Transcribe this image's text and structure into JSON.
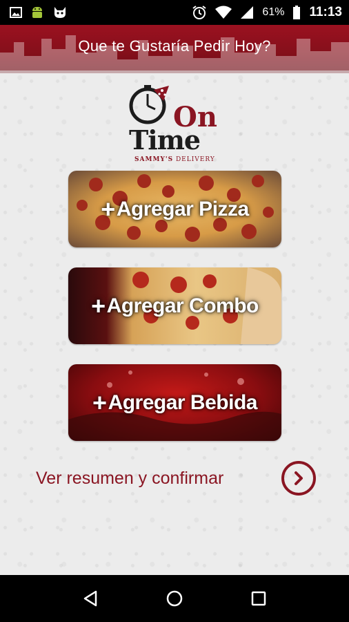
{
  "status_bar": {
    "left_icons": [
      "image-icon",
      "android-icon",
      "cat-icon"
    ],
    "right_icons": [
      "alarm-icon",
      "wifi-icon",
      "signal-icon"
    ],
    "battery": "61%",
    "time": "11:13"
  },
  "header": {
    "title": "Que te Gustaría Pedir Hoy?"
  },
  "logo": {
    "line1": "On",
    "line2": "Time",
    "subtitle_bold": "SAMMY'S",
    "subtitle_rest": " DELIVERY"
  },
  "actions": [
    {
      "plus": "+",
      "label": "Agregar Pizza"
    },
    {
      "plus": "+",
      "label": "Agregar Combo"
    },
    {
      "plus": "+",
      "label": "Agregar Bebida"
    }
  ],
  "confirm": {
    "label": "Ver resumen y confirmar",
    "icon": "chevron-right-icon"
  },
  "nav_bar": {
    "icons": [
      "back-icon",
      "home-icon",
      "recents-icon"
    ]
  },
  "colors": {
    "brand": "#8a1522",
    "header": "#9b1120",
    "background": "#ececec"
  }
}
